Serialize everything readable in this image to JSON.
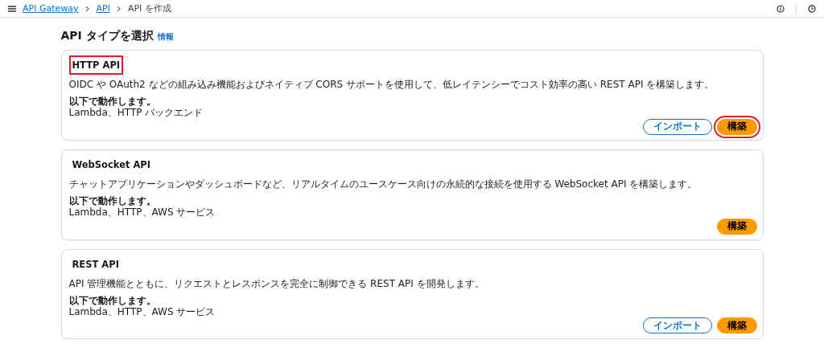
{
  "breadcrumbs": [
    {
      "label": "API Gateway",
      "link": true
    },
    {
      "label": "API",
      "link": true
    },
    {
      "label": "API を作成",
      "link": false
    }
  ],
  "page": {
    "title": "API タイプを選択",
    "info_link": "情報"
  },
  "cards": [
    {
      "title": "HTTP API",
      "title_highlighted": true,
      "description": "OIDC や OAuth2 などの組み込み機能およびネイティブ CORS サポートを使用して、低レイテンシーでコスト効率の高い REST API を構築します。",
      "works_with_label": "以下で動作します。",
      "works_with": "Lambda、HTTP バックエンド",
      "buttons": [
        {
          "label": "インポート",
          "kind": "secondary",
          "highlighted": false
        },
        {
          "label": "構築",
          "kind": "primary",
          "highlighted": true
        }
      ]
    },
    {
      "title": "WebSocket API",
      "title_highlighted": false,
      "description": "チャットアプリケーションやダッシュボードなど、リアルタイムのユースケース向けの永続的な接続を使用する WebSocket API を構築します。",
      "works_with_label": "以下で動作します。",
      "works_with": "Lambda、HTTP、AWS サービス",
      "buttons": [
        {
          "label": "構築",
          "kind": "primary",
          "highlighted": false
        }
      ]
    },
    {
      "title": "REST API",
      "title_highlighted": false,
      "description": "API 管理機能とともに、リクエストとレスポンスを完全に制御できる REST API を開発します。",
      "works_with_label": "以下で動作します。",
      "works_with": "Lambda、HTTP、AWS サービス",
      "buttons": [
        {
          "label": "インポート",
          "kind": "secondary",
          "highlighted": false
        },
        {
          "label": "構築",
          "kind": "primary",
          "highlighted": false
        }
      ]
    }
  ]
}
